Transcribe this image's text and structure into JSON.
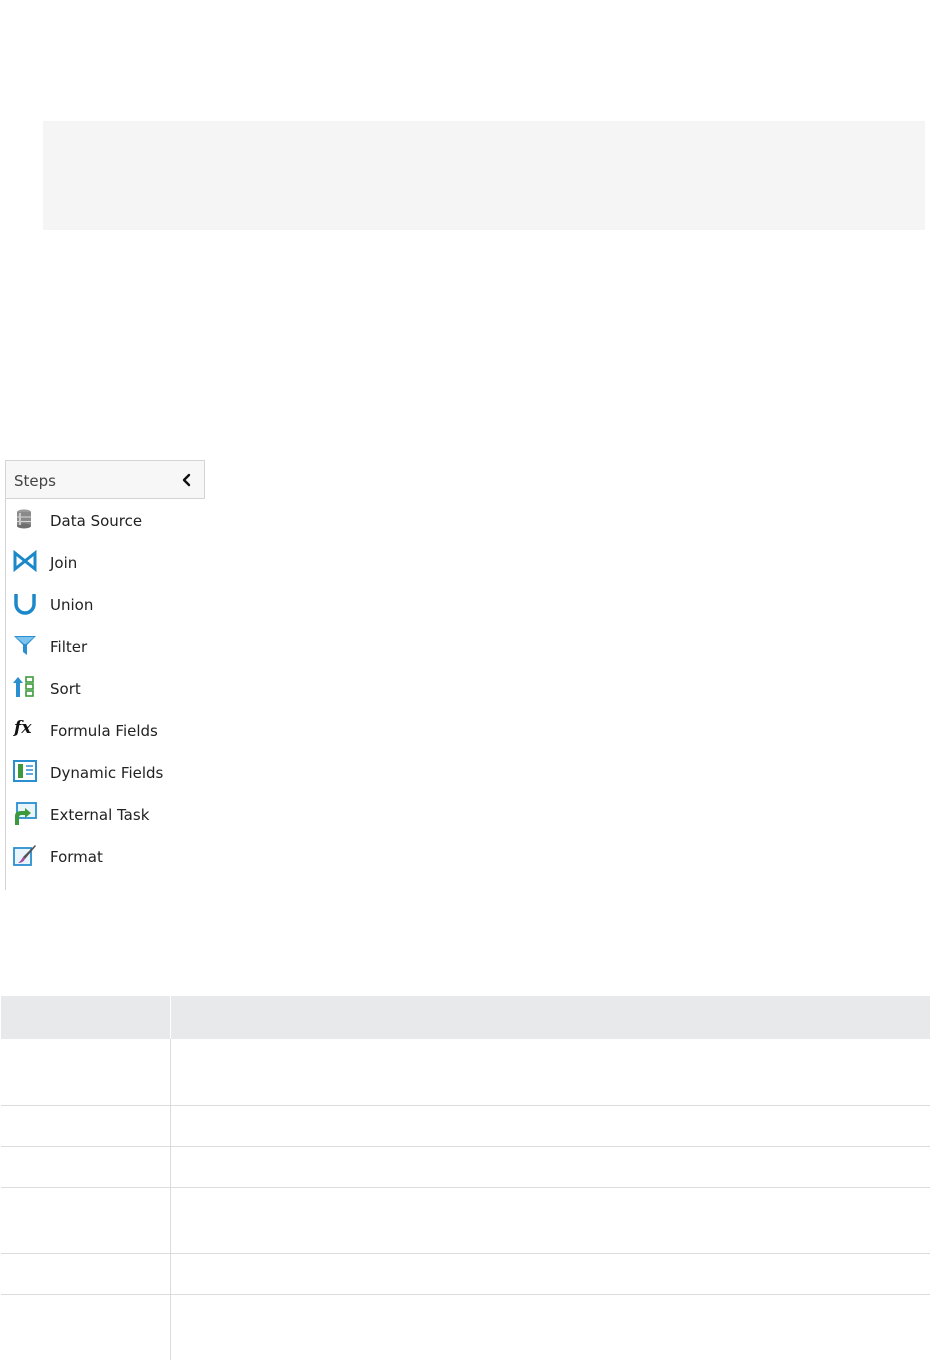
{
  "panel": {
    "title": "Steps",
    "collapse_icon": "chevron-left-icon",
    "items": [
      {
        "label": "Data Source",
        "icon": "database-icon"
      },
      {
        "label": "Join",
        "icon": "join-icon"
      },
      {
        "label": "Union",
        "icon": "union-icon"
      },
      {
        "label": "Filter",
        "icon": "filter-funnel-icon"
      },
      {
        "label": "Sort",
        "icon": "sort-icon"
      },
      {
        "label": "Formula Fields",
        "icon": "fx-formula-icon"
      },
      {
        "label": "Dynamic Fields",
        "icon": "dynamic-fields-icon"
      },
      {
        "label": "External Task",
        "icon": "external-task-icon"
      },
      {
        "label": "Format",
        "icon": "format-brush-icon"
      }
    ]
  },
  "colors": {
    "accent_blue": "#1a88c9",
    "header_bg": "#e8e9ea",
    "note_bg": "#f5f5f5"
  }
}
